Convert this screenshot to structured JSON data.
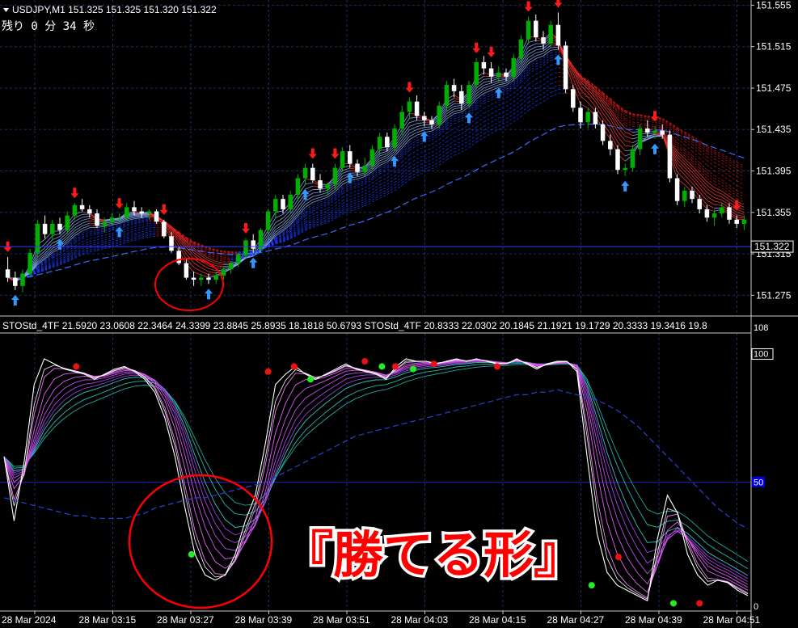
{
  "header": {
    "symbol_line": "USDJPY,M1  151.325 151.325 151.320 151.322",
    "timer": "残り 0 分 34 秒"
  },
  "indicator": {
    "label": "STOStd_4TF 21.5920 23.0608 22.3464 24.3399 23.8845 25.8935 18.1818 50.6793   STOStd_4TF 20.8333 22.0302 20.1845 21.1921 19.1729 20.3333 19.3416 19.8"
  },
  "annotation": {
    "text": "『勝てる形』"
  },
  "colors": {
    "bull": "#00b000",
    "bear": "#ffffff",
    "up_arrow": "#3399ff",
    "down_arrow": "#ff1a1a",
    "grid": "#1c2e62",
    "level_line": "#2222cc",
    "circle": "#ff0000"
  },
  "chart_data": [
    {
      "type": "candlestick",
      "symbol": "USDJPY,M1",
      "y_ticks": [
        "151.555",
        "151.515",
        "151.475",
        "151.435",
        "151.395",
        "151.355",
        "151.315",
        "151.275"
      ],
      "current_price": "151.322",
      "ylim": [
        151.255,
        151.56
      ],
      "grid": true,
      "candles": [
        [
          151.3,
          151.312,
          151.288,
          151.292
        ],
        [
          151.292,
          151.298,
          151.28,
          151.284
        ],
        [
          151.284,
          151.3,
          151.278,
          151.296
        ],
        [
          151.296,
          151.32,
          151.292,
          151.316
        ],
        [
          151.316,
          151.348,
          151.312,
          151.344
        ],
        [
          151.344,
          151.352,
          151.33,
          151.334
        ],
        [
          151.334,
          151.348,
          151.328,
          151.344
        ],
        [
          151.344,
          151.35,
          151.334,
          151.338
        ],
        [
          151.338,
          151.356,
          151.334,
          151.352
        ],
        [
          151.352,
          151.364,
          151.348,
          151.362
        ],
        [
          151.362,
          151.368,
          151.356,
          151.358
        ],
        [
          151.358,
          151.362,
          151.35,
          151.354
        ],
        [
          151.354,
          151.358,
          151.34,
          151.342
        ],
        [
          151.342,
          151.35,
          151.336,
          151.346
        ],
        [
          151.346,
          151.354,
          151.342,
          151.35
        ],
        [
          151.35,
          151.354,
          151.346,
          151.35
        ],
        [
          151.35,
          151.364,
          151.346,
          151.36
        ],
        [
          151.36,
          151.366,
          151.352,
          151.356
        ],
        [
          151.356,
          151.36,
          151.35,
          151.354
        ],
        [
          151.354,
          151.358,
          151.348,
          151.356
        ],
        [
          151.356,
          151.358,
          151.344,
          151.346
        ],
        [
          151.346,
          151.348,
          151.33,
          151.332
        ],
        [
          151.332,
          151.336,
          151.316,
          151.318
        ],
        [
          151.318,
          151.322,
          151.304,
          151.306
        ],
        [
          151.306,
          151.31,
          151.29,
          151.292
        ],
        [
          151.292,
          151.298,
          151.284,
          151.29
        ],
        [
          151.29,
          151.296,
          151.284,
          151.292
        ],
        [
          151.292,
          151.296,
          151.286,
          151.29
        ],
        [
          151.29,
          151.298,
          151.286,
          151.294
        ],
        [
          151.294,
          151.302,
          151.29,
          151.3
        ],
        [
          151.3,
          151.308,
          151.296,
          151.306
        ],
        [
          151.306,
          151.316,
          151.302,
          151.314
        ],
        [
          151.314,
          151.33,
          151.31,
          151.328
        ],
        [
          151.328,
          151.334,
          151.316,
          151.32
        ],
        [
          151.32,
          151.34,
          151.316,
          151.338
        ],
        [
          151.338,
          151.358,
          151.334,
          151.356
        ],
        [
          151.356,
          151.372,
          151.35,
          151.368
        ],
        [
          151.368,
          151.372,
          151.354,
          151.358
        ],
        [
          151.358,
          151.376,
          151.354,
          151.372
        ],
        [
          151.372,
          151.392,
          151.366,
          151.388
        ],
        [
          151.388,
          151.402,
          151.382,
          151.398
        ],
        [
          151.398,
          151.402,
          151.384,
          151.386
        ],
        [
          151.386,
          151.392,
          151.374,
          151.378
        ],
        [
          151.378,
          151.384,
          151.372,
          151.382
        ],
        [
          151.382,
          151.402,
          151.378,
          151.398
        ],
        [
          151.398,
          151.418,
          151.394,
          151.414
        ],
        [
          151.414,
          151.42,
          151.398,
          151.402
        ],
        [
          151.402,
          151.406,
          151.39,
          151.394
        ],
        [
          151.394,
          151.408,
          151.39,
          151.4
        ],
        [
          151.4,
          151.42,
          151.396,
          151.416
        ],
        [
          151.416,
          151.432,
          151.41,
          151.428
        ],
        [
          151.428,
          151.432,
          151.414,
          151.418
        ],
        [
          151.418,
          151.44,
          151.414,
          151.436
        ],
        [
          151.436,
          151.458,
          151.43,
          151.452
        ],
        [
          151.452,
          151.466,
          151.446,
          151.462
        ],
        [
          151.462,
          151.468,
          151.444,
          151.448
        ],
        [
          151.448,
          151.452,
          151.438,
          151.444
        ],
        [
          151.444,
          151.448,
          151.436,
          151.44
        ],
        [
          151.44,
          151.462,
          151.436,
          151.458
        ],
        [
          151.458,
          151.482,
          151.452,
          151.478
        ],
        [
          151.478,
          151.484,
          151.466,
          151.472
        ],
        [
          151.472,
          151.478,
          151.454,
          151.46
        ],
        [
          151.46,
          151.482,
          151.456,
          151.478
        ],
        [
          151.478,
          151.504,
          151.474,
          151.5
        ],
        [
          151.5,
          151.506,
          151.488,
          151.494
        ],
        [
          151.494,
          151.5,
          151.48,
          151.486
        ],
        [
          151.486,
          151.496,
          151.48,
          151.49
        ],
        [
          151.49,
          151.494,
          151.482,
          151.486
        ],
        [
          151.486,
          151.508,
          151.482,
          151.504
        ],
        [
          151.504,
          151.526,
          151.5,
          151.522
        ],
        [
          151.522,
          151.544,
          151.518,
          151.54
        ],
        [
          151.54,
          151.546,
          151.52,
          151.524
        ],
        [
          151.524,
          151.53,
          151.512,
          151.518
        ],
        [
          151.518,
          151.54,
          151.514,
          151.536
        ],
        [
          151.536,
          151.548,
          151.512,
          151.516
        ],
        [
          151.516,
          151.52,
          151.47,
          151.474
        ],
        [
          151.474,
          151.478,
          151.452,
          151.456
        ],
        [
          151.456,
          151.462,
          151.436,
          151.442
        ],
        [
          151.442,
          151.456,
          151.436,
          151.452
        ],
        [
          151.452,
          151.456,
          151.436,
          151.44
        ],
        [
          151.44,
          151.444,
          151.42,
          151.424
        ],
        [
          151.424,
          151.43,
          151.41,
          151.416
        ],
        [
          151.416,
          151.42,
          151.392,
          151.396
        ],
        [
          151.396,
          151.402,
          151.39,
          151.398
        ],
        [
          151.398,
          151.42,
          151.394,
          151.416
        ],
        [
          151.416,
          151.44,
          151.41,
          151.436
        ],
        [
          151.436,
          151.444,
          151.428,
          151.432
        ],
        [
          151.432,
          151.438,
          151.426,
          151.434
        ],
        [
          151.434,
          151.44,
          151.426,
          151.43
        ],
        [
          151.43,
          151.434,
          151.384,
          151.388
        ],
        [
          151.388,
          151.392,
          151.362,
          151.366
        ],
        [
          151.366,
          151.38,
          151.36,
          151.376
        ],
        [
          151.376,
          151.38,
          151.364,
          151.368
        ],
        [
          151.368,
          151.372,
          151.354,
          151.358
        ],
        [
          151.358,
          151.362,
          151.346,
          151.35
        ],
        [
          151.35,
          151.358,
          151.342,
          151.354
        ],
        [
          151.354,
          151.364,
          151.35,
          151.36
        ],
        [
          151.36,
          151.364,
          151.344,
          151.348
        ],
        [
          151.348,
          151.352,
          151.34,
          151.344
        ],
        [
          151.344,
          151.352,
          151.338,
          151.348
        ]
      ],
      "up_arrow_candles": [
        1,
        7,
        15,
        27,
        33,
        40,
        46,
        52,
        56,
        62,
        66,
        74,
        83,
        87
      ],
      "down_arrow_candles": [
        0,
        9,
        15,
        21,
        32,
        41,
        44,
        54,
        63,
        65,
        70,
        74,
        87,
        98
      ]
    },
    {
      "type": "line",
      "name": "STOStd_4TF",
      "y_ticks": [
        "108",
        "100",
        "50",
        "0"
      ],
      "ylim": [
        0,
        108
      ],
      "level_line": 50,
      "series_main": [
        60,
        35,
        58,
        88,
        98,
        96,
        94,
        93,
        92,
        90,
        92,
        94,
        95,
        93,
        90,
        85,
        75,
        60,
        40,
        22,
        14,
        12,
        14,
        22,
        35,
        45,
        65,
        88,
        92,
        95,
        92,
        90,
        92,
        94,
        96,
        94,
        93,
        92,
        90,
        95,
        98,
        97,
        97,
        96,
        97,
        98,
        97,
        98,
        97,
        96,
        96,
        98,
        96,
        94,
        96,
        97,
        97,
        93,
        60,
        30,
        15,
        10,
        8,
        6,
        4,
        28,
        45,
        38,
        22,
        14,
        10,
        12,
        11,
        8,
        6
      ],
      "series_slow": [
        44,
        43,
        42,
        41,
        40,
        39,
        38,
        37,
        37,
        36,
        36,
        36,
        36,
        37,
        38,
        40,
        41,
        42,
        43,
        44,
        44,
        45,
        46,
        47,
        48,
        49,
        50,
        52,
        54,
        56,
        58,
        60,
        62,
        64,
        66,
        68,
        69,
        70,
        71,
        72,
        73,
        74,
        75,
        76,
        77,
        78,
        79,
        80,
        81,
        82,
        83,
        84,
        84,
        85,
        85,
        86,
        85,
        84,
        83,
        82,
        80,
        78,
        75,
        72,
        68,
        64,
        60,
        56,
        52,
        48,
        44,
        40,
        37,
        34,
        32
      ],
      "green_dots": [
        [
          0.252,
          22
        ],
        [
          0.412,
          90
        ],
        [
          0.508,
          95
        ],
        [
          0.55,
          94
        ],
        [
          0.79,
          10
        ],
        [
          0.9,
          3
        ]
      ],
      "red_dots": [
        [
          0.097,
          95
        ],
        [
          0.355,
          93
        ],
        [
          0.39,
          95
        ],
        [
          0.485,
          97
        ],
        [
          0.526,
          95
        ],
        [
          0.578,
          96
        ],
        [
          0.663,
          95
        ],
        [
          0.826,
          21
        ],
        [
          0.935,
          3
        ]
      ]
    }
  ],
  "x_axis": {
    "labels": [
      "28 Mar 2024",
      "28 Mar 03:15",
      "28 Mar 03:27",
      "28 Mar 03:39",
      "28 Mar 03:51",
      "28 Mar 04:03",
      "28 Mar 04:15",
      "28 Mar 04:27",
      "28 Mar 04:39",
      "28 Mar 04:51"
    ]
  }
}
